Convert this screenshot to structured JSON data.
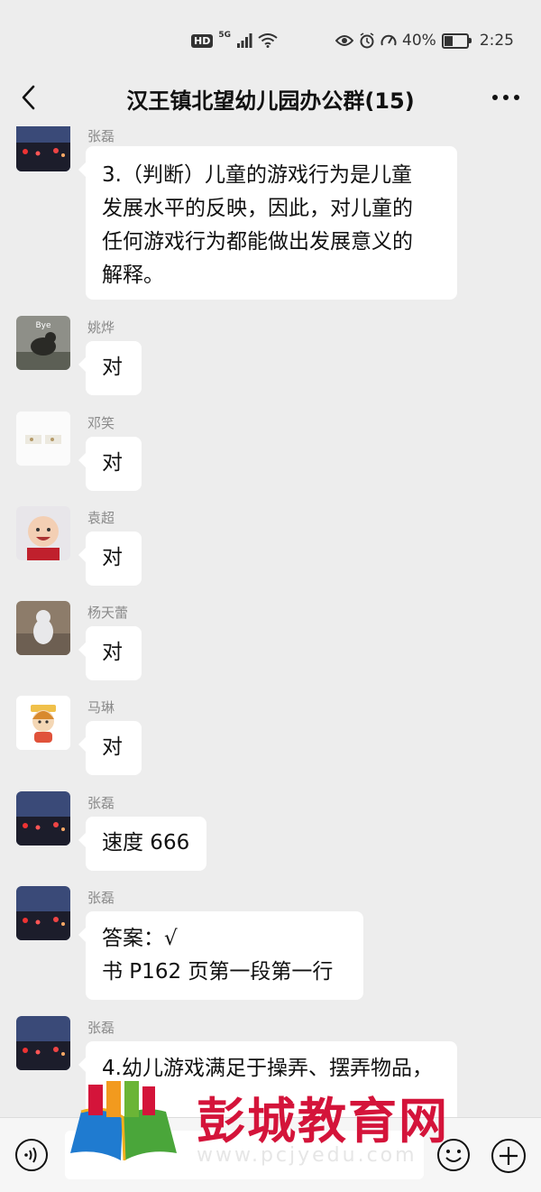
{
  "status_bar": {
    "hd": "HD",
    "network": "5G",
    "battery": "40%",
    "battery_level": 0.4,
    "time": "2:25"
  },
  "header": {
    "title": "汉王镇北望幼儿园办公群(15)"
  },
  "messages": [
    {
      "sender": "张磊",
      "avatar": "dusk-street-photo",
      "lines": [
        "3.（判断）儿童的游戏行为是儿童",
        "发展水平的反映，因此，对儿童的",
        "任何游戏行为都能做出发展意义的",
        "解释。"
      ]
    },
    {
      "sender": "姚烨",
      "avatar": "animal-bye-sticker",
      "lines": [
        "对"
      ]
    },
    {
      "sender": "邓笑",
      "avatar": "small-figures-image",
      "lines": [
        "对"
      ]
    },
    {
      "sender": "袁超",
      "avatar": "smiling-baby-photo",
      "lines": [
        "对"
      ]
    },
    {
      "sender": "杨天蕾",
      "avatar": "plush-toy-photo",
      "lines": [
        "对"
      ]
    },
    {
      "sender": "马琳",
      "avatar": "cartoon-girl-sticker",
      "lines": [
        "对"
      ]
    },
    {
      "sender": "张磊",
      "avatar": "dusk-street-photo",
      "lines": [
        "速度 666"
      ]
    },
    {
      "sender": "张磊",
      "avatar": "dusk-street-photo",
      "lines": [
        "答案：√",
        "书 P162 页第一段第一行"
      ]
    },
    {
      "sender": "张磊",
      "avatar": "dusk-street-photo",
      "lines": [
        "4.幼儿游戏满足于操弄、摆弄物品，"
      ]
    }
  ],
  "watermark": {
    "text": "彭城教育网",
    "url": "www.pcjyedu.com",
    "color": "#d4143a"
  },
  "icons": {
    "back": "back-chevron-icon",
    "more": "more-dots-icon",
    "voice": "voice-icon",
    "emoji": "emoji-icon",
    "plus": "plus-icon"
  }
}
